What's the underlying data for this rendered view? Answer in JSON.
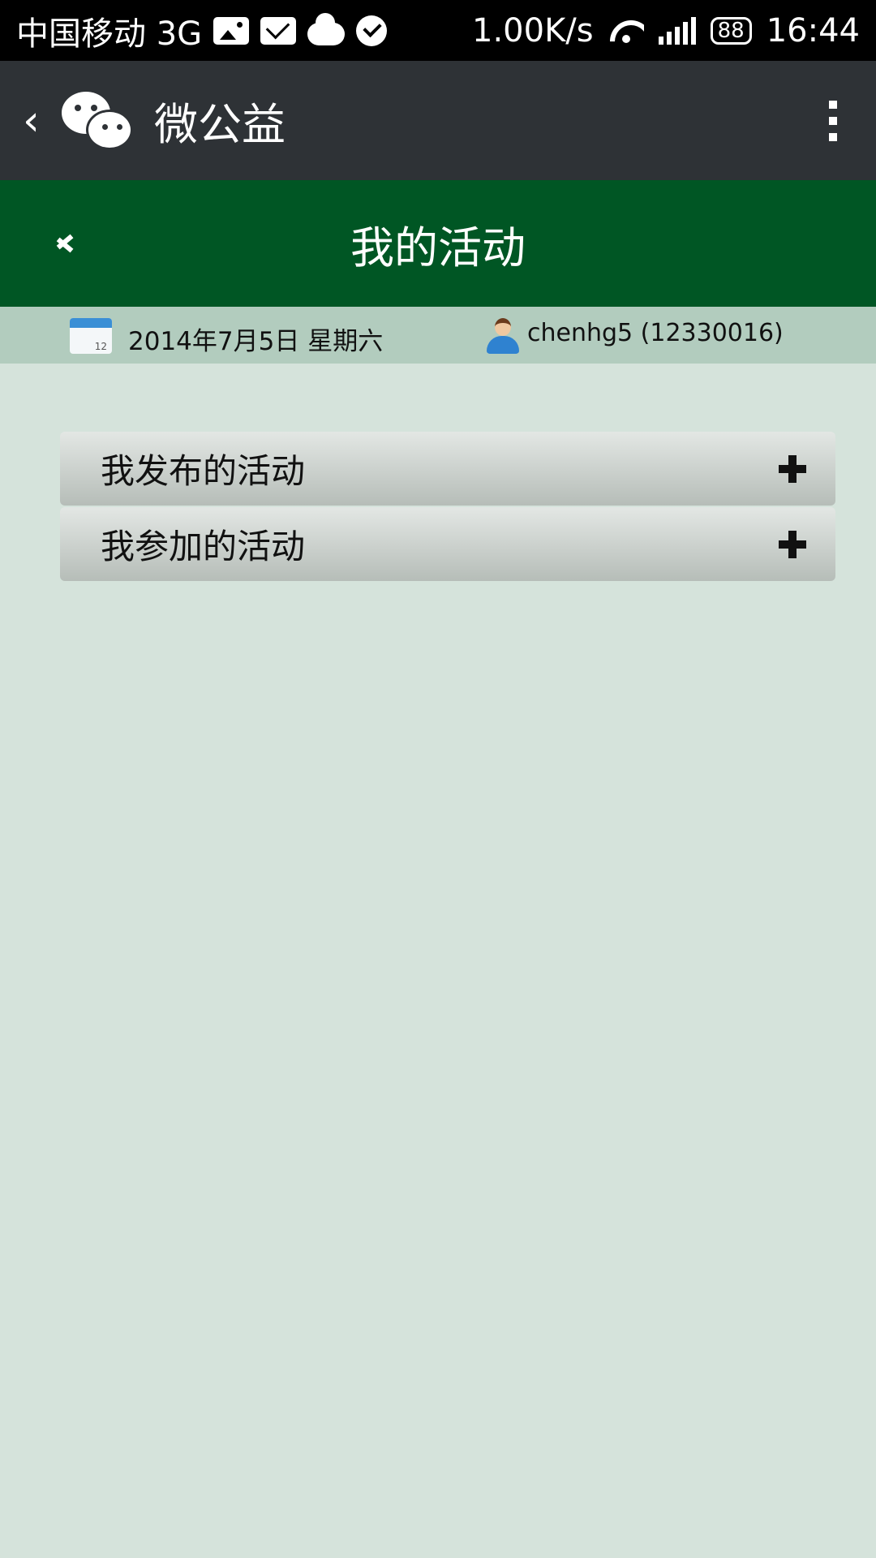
{
  "status_bar": {
    "carrier": "中国移动 3G",
    "speed": "1.00K/s",
    "battery": "88",
    "time": "16:44",
    "icons": [
      "image-icon",
      "mail-icon",
      "cloud-icon",
      "check-icon",
      "wifi-icon",
      "signal-icon",
      "battery-icon"
    ]
  },
  "wechat_header": {
    "title": "微公益",
    "back_icon": "chevron-left-icon",
    "menu_icon": "more-vertical-icon"
  },
  "page_header": {
    "title": "我的活动",
    "back_icon": "double-chevron-left-icon",
    "color": "#005624"
  },
  "info_bar": {
    "date": "2014年7月5日  星期六",
    "user": "chenhg5 (12330016)"
  },
  "accordion": {
    "items": [
      {
        "label": "我发布的活动"
      },
      {
        "label": "我参加的活动"
      }
    ]
  }
}
